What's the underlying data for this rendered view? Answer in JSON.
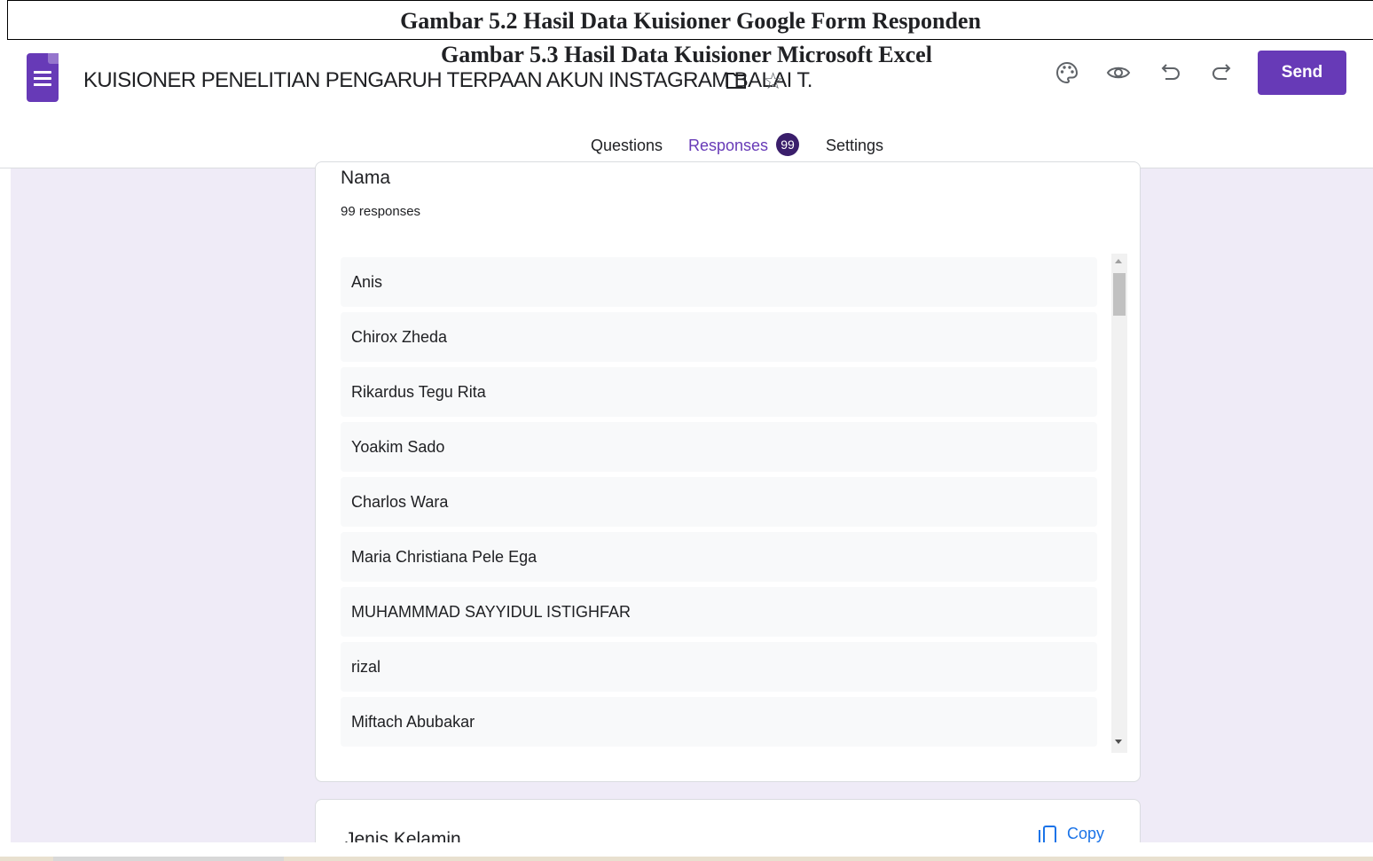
{
  "captions": {
    "caption_1": "Gambar 5.2 Hasil Data Kuisioner Google Form Responden",
    "caption_2": "Gambar 5.3 Hasil Data Kuisioner Microsoft Excel"
  },
  "header": {
    "form_title": "KUISIONER PENELITIAN PENGARUH TERPAAN AKUN INSTAGRAM BALAI T.",
    "send_label": "Send",
    "icons": [
      "forms-logo-icon",
      "folder-icon",
      "star-icon",
      "palette-icon",
      "eye-icon",
      "undo-icon",
      "redo-icon"
    ]
  },
  "tabs": {
    "questions": "Questions",
    "responses": "Responses",
    "responses_count": "99",
    "settings": "Settings",
    "accent_color": "#673ab7"
  },
  "question_1": {
    "title": "Nama",
    "count": "99 responses",
    "responses": [
      "Anis",
      "Chirox Zheda",
      "Rikardus Tegu Rita",
      "Yoakim Sado",
      "Charlos Wara",
      "Maria Christiana Pele Ega",
      "MUHAMMMAD SAYYIDUL ISTIGHFAR",
      "rizal",
      "Miftach Abubakar"
    ]
  },
  "question_2": {
    "title": "Jenis Kelamin",
    "copy_label": "Copy"
  }
}
